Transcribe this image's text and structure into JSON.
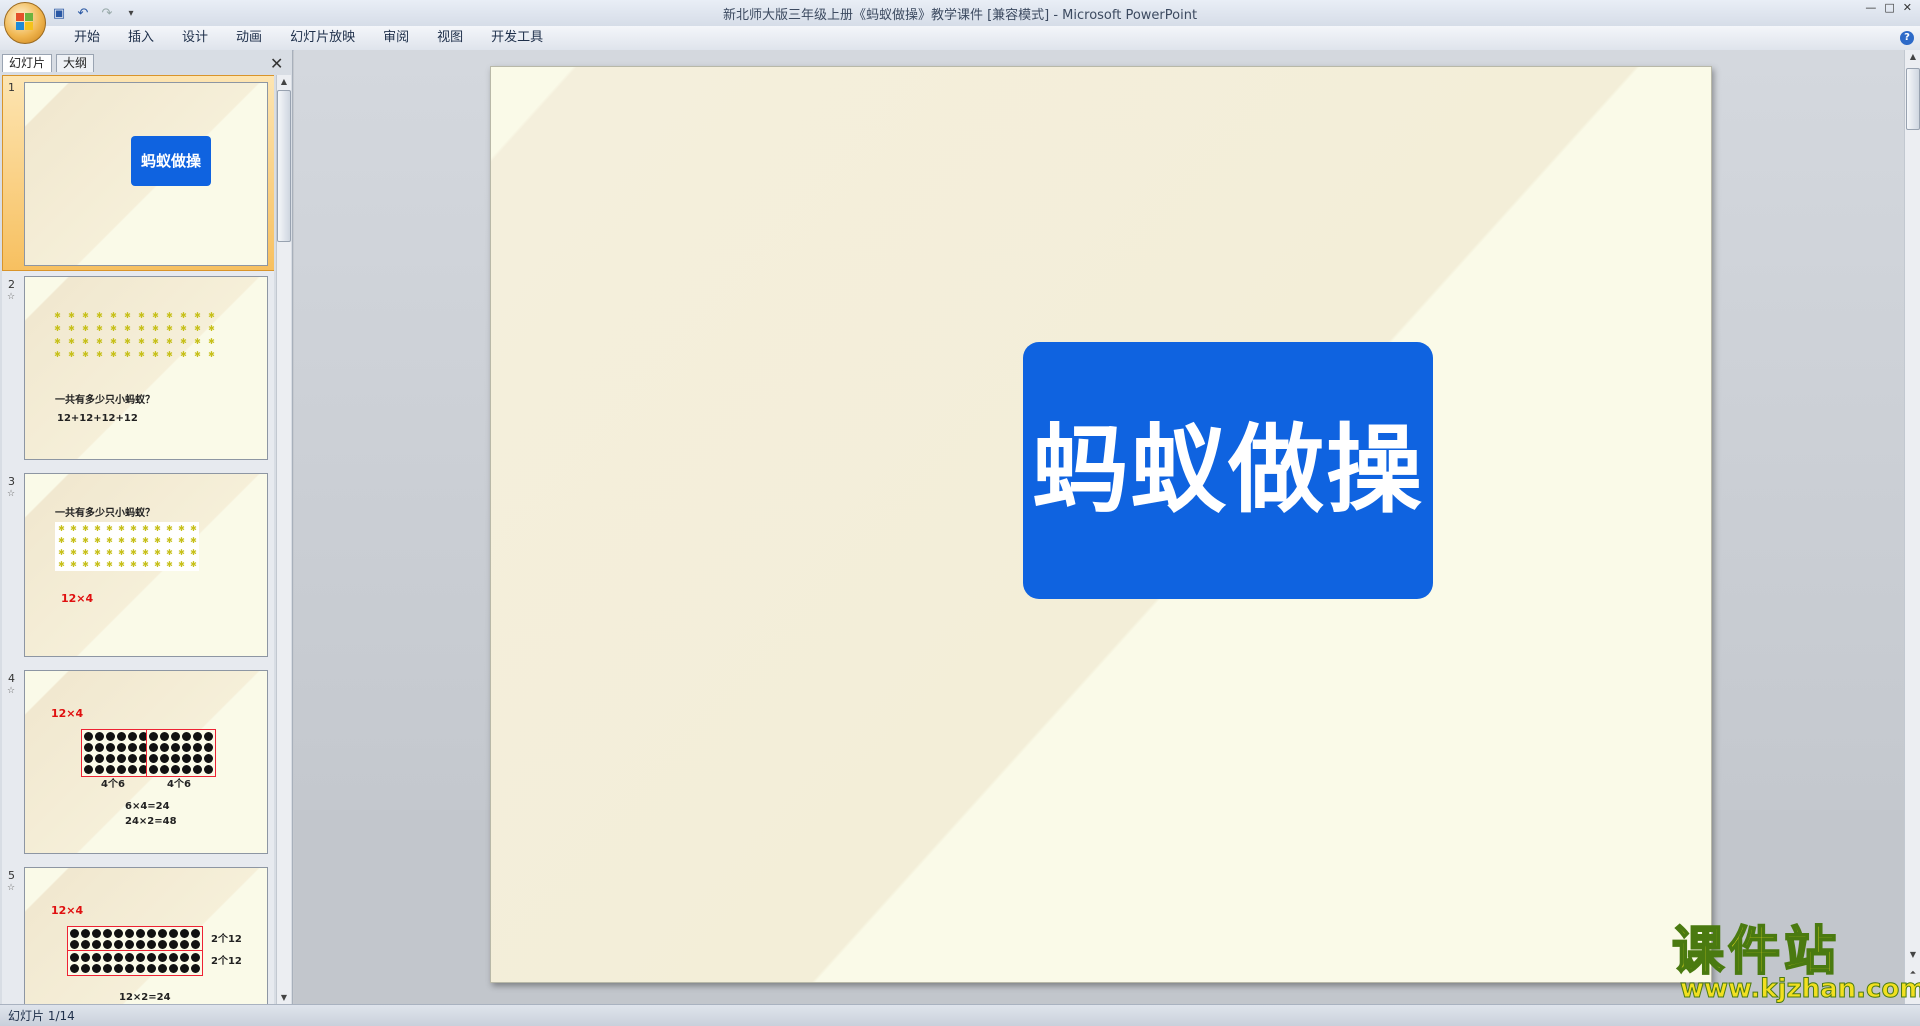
{
  "window": {
    "title": "新北师大版三年级上册《蚂蚁做操》教学课件 [兼容模式] - Microsoft PowerPoint"
  },
  "qat": {
    "save_icon": "save-icon",
    "undo_icon": "undo-icon",
    "redo_icon": "redo-icon",
    "customize": "▾"
  },
  "ribbon": {
    "tabs": [
      "开始",
      "插入",
      "设计",
      "动画",
      "幻灯片放映",
      "审阅",
      "视图",
      "开发工具"
    ]
  },
  "left_pane": {
    "tab_slides": "幻灯片",
    "tab_outline": "大纲",
    "close": "✕",
    "thumbnails": [
      {
        "num": "1",
        "title": "蚂蚁做操"
      },
      {
        "num": "2",
        "question": "一共有多少只小蚂蚁？",
        "expr": "12+12+12+12"
      },
      {
        "num": "3",
        "question": "一共有多少只小蚂蚁？",
        "expr": "12×4"
      },
      {
        "num": "4",
        "expr": "12×4",
        "brace1": "4个6",
        "brace2": "4个6",
        "line1": "6×4=24",
        "line2": "24×2=48"
      },
      {
        "num": "5",
        "expr": "12×4",
        "brace1": "2个12",
        "brace2": "2个12",
        "line1": "12×2=24"
      }
    ]
  },
  "slide": {
    "title": "蚂蚁做操",
    "colors": {
      "background": "#fafae8",
      "title_box": "#0f63e0"
    }
  },
  "status": {
    "slide_position": "幻灯片 1/14"
  },
  "watermark": {
    "cn": "课件站",
    "url": "www.kjzhan.com"
  }
}
